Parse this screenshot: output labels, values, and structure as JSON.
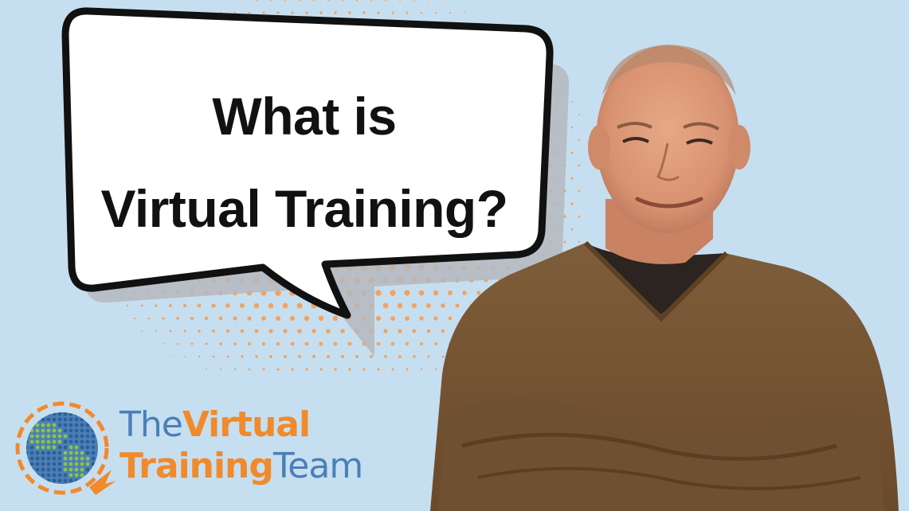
{
  "bubble": {
    "line1": "What is",
    "line2": "Virtual Training?"
  },
  "logo": {
    "word1": "The",
    "word2": "Virtual",
    "word3": "Training",
    "word4": "Team"
  },
  "colors": {
    "background": "#c6dff0",
    "halftone": "#f3a262",
    "brand_orange": "#f08a2c",
    "brand_blue": "#4a7fb8",
    "brand_green": "#8cc63f",
    "sweater": "#7b5a36"
  },
  "icons": [
    "speech-bubble",
    "globe-logo-icon",
    "person-photo"
  ]
}
